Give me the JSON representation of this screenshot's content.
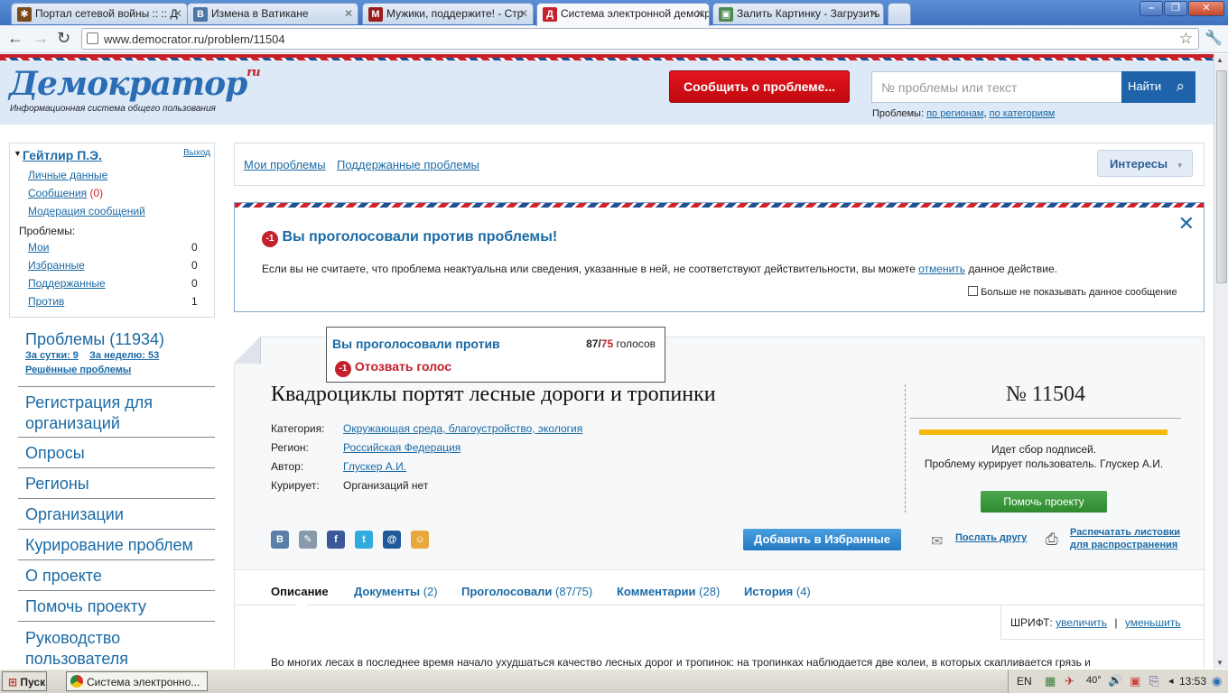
{
  "browser": {
    "tabs": [
      {
        "title": "Портал сетевой войны :: :: Д",
        "favicon": "star-icon",
        "color": "#7a4b1a"
      },
      {
        "title": "Измена в Ватикане",
        "favicon": "vk-icon",
        "color": "#4a76a8"
      },
      {
        "title": "Мужики, поддержите! - Стр",
        "favicon": "red-site-icon",
        "color": "#9b1c1c"
      },
      {
        "title": "Система электронной демокр",
        "favicon": "democrator-icon",
        "color": "#c3212b"
      },
      {
        "title": "Залить Картинку - Загрузить",
        "favicon": "image-icon",
        "color": "#4e8a4e"
      }
    ],
    "url": "www.democrator.ru/problem/11504"
  },
  "header": {
    "logo_text": "Демократор",
    "logo_suffix": "ru",
    "logo_tagline": "Информационная система общего пользования",
    "report_button": "Сообщить о проблеме...",
    "search_placeholder": "№ проблемы или текст",
    "search_button": "Найти",
    "problems_label": "Проблемы:",
    "by_regions": "по регионам",
    "by_categories": "по категориям"
  },
  "user_box": {
    "name": "Гейтлир П.Э.",
    "logout": "Выход",
    "personal": "Личные данные",
    "messages": "Сообщения",
    "messages_count": "(0)",
    "moderation": "Модерация сообщений",
    "problems_label": "Проблемы:",
    "items": [
      {
        "label": "Мои",
        "count": "0"
      },
      {
        "label": "Избранные",
        "count": "0"
      },
      {
        "label": "Поддержанные",
        "count": "0"
      },
      {
        "label": "Против",
        "count": "1"
      }
    ]
  },
  "left_nav": {
    "problems": "Проблемы (11934)",
    "day": "За сутки: 9",
    "week": "За неделю: 53",
    "solved": "Решённые проблемы",
    "items": [
      "Регистрация для организаций",
      "Опросы",
      "Регионы",
      "Организации",
      "Курирование проблем",
      "О проекте",
      "Помочь проекту",
      "Руководство пользователя"
    ]
  },
  "top_links": {
    "my": "Мои проблемы",
    "supported": "Поддержанные проблемы",
    "interests": "Интересы"
  },
  "notice": {
    "badge": "-1",
    "title": "Вы проголосовали против проблемы!",
    "text_before": "Если вы не считаете, что проблема неактуальна или сведения, указанные в ней, не соответствуют действительности, вы можете",
    "link": "отменить",
    "text_after": "данное действие.",
    "checkbox_label": "Больше не показывать данное сообщение"
  },
  "vote_box": {
    "title": "Вы проголосовали против",
    "votes_for": "87",
    "votes_sep": "/",
    "votes_against": "75",
    "votes_label": "голосов",
    "badge": "-1",
    "revoke": "Отозвать голос"
  },
  "problem": {
    "title": "Квадроциклы портят лесные дороги и тропинки",
    "number": "№ 11504",
    "fields": [
      {
        "label": "Категория:",
        "value": "Окружающая среда, благоустройство, экология",
        "link": true
      },
      {
        "label": "Регион:",
        "value": "Российская Федерация",
        "link": true
      },
      {
        "label": "Автор:",
        "value": "Глускер А.И.",
        "link": true
      },
      {
        "label": "Курирует:",
        "value": "Организаций нет",
        "link": false
      }
    ],
    "status": "Идет сбор подписей.",
    "curated": "Проблему курирует пользователь. Глускер А.И.",
    "help_button": "Помочь проекту",
    "favorites_button": "Добавить в Избранные",
    "send_friend": "Послать другу",
    "print_line1": "Распечатать листовки",
    "print_line2": "для распространения",
    "social": [
      {
        "name": "vkontakte-icon",
        "glyph": "В",
        "color": "#5b7fa6"
      },
      {
        "name": "livejournal-icon",
        "glyph": "✎",
        "color": "#8899aa"
      },
      {
        "name": "facebook-icon",
        "glyph": "f",
        "color": "#3b5998"
      },
      {
        "name": "twitter-icon",
        "glyph": "t",
        "color": "#33aadd"
      },
      {
        "name": "mailru-icon",
        "glyph": "@",
        "color": "#1f5a9a"
      },
      {
        "name": "odnoklassniki-icon",
        "glyph": "☺",
        "color": "#e8a83c"
      }
    ]
  },
  "tabs": [
    {
      "label": "Описание",
      "count": ""
    },
    {
      "label": "Документы",
      "count": "(2)"
    },
    {
      "label": "Проголосовали",
      "count": "(87/75)"
    },
    {
      "label": "Комментарии",
      "count": "(28)"
    },
    {
      "label": "История",
      "count": "(4)"
    }
  ],
  "font_controls": {
    "label": "ШРИФТ:",
    "increase": "увеличить",
    "sep": "|",
    "decrease": "уменьшить"
  },
  "description": "Во многих лесах в последнее время начало ухудшаться качество лесных дорог и тропинок: на тропинках наблюдается две колеи, в которых скапливается грязь и",
  "taskbar": {
    "start": "Пуск",
    "window": "Система электронно...",
    "lang": "EN",
    "temp": "40°",
    "clock": "13:53"
  }
}
